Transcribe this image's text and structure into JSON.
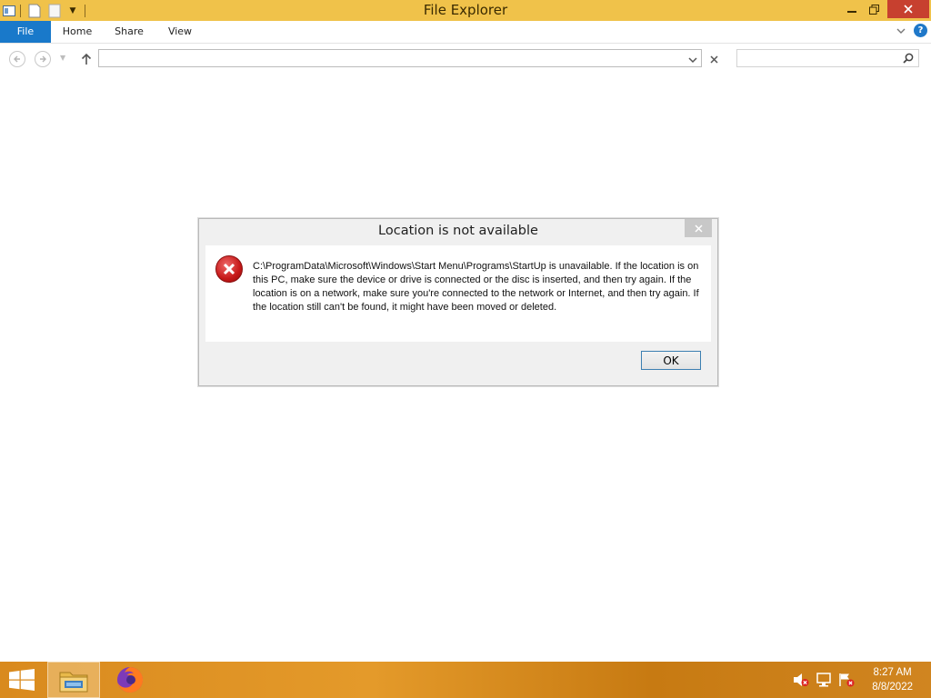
{
  "window": {
    "title": "File Explorer",
    "accent": "#f0c24a",
    "controls": {
      "minimize_icon": "minimize-icon",
      "restore_icon": "restore-icon",
      "close_icon": "close-icon"
    }
  },
  "ribbon": {
    "tabs": [
      {
        "label": "File",
        "active": true
      },
      {
        "label": "Home"
      },
      {
        "label": "Share"
      },
      {
        "label": "View"
      }
    ]
  },
  "addressbar": {
    "value": "",
    "search_placeholder": ""
  },
  "dialog": {
    "title": "Location is not available",
    "icon": "error-icon",
    "message": "C:\\ProgramData\\Microsoft\\Windows\\Start Menu\\Programs\\StartUp is unavailable. If the location is on this PC, make sure the device or drive is connected or the disc is inserted, and then try again. If the location is on a network, make sure you're connected to the network or Internet, and then try again. If the location still can't be found, it might have been moved or deleted.",
    "ok_label": "OK"
  },
  "taskbar": {
    "apps": [
      {
        "name": "File Explorer",
        "icon": "folder-icon",
        "active": true
      },
      {
        "name": "Firefox",
        "icon": "firefox-icon",
        "active": false
      }
    ],
    "tray_icons": [
      "volume-muted-icon",
      "network-icon",
      "action-center-flag-icon"
    ],
    "time": "8:27 AM",
    "date": "8/8/2022"
  }
}
